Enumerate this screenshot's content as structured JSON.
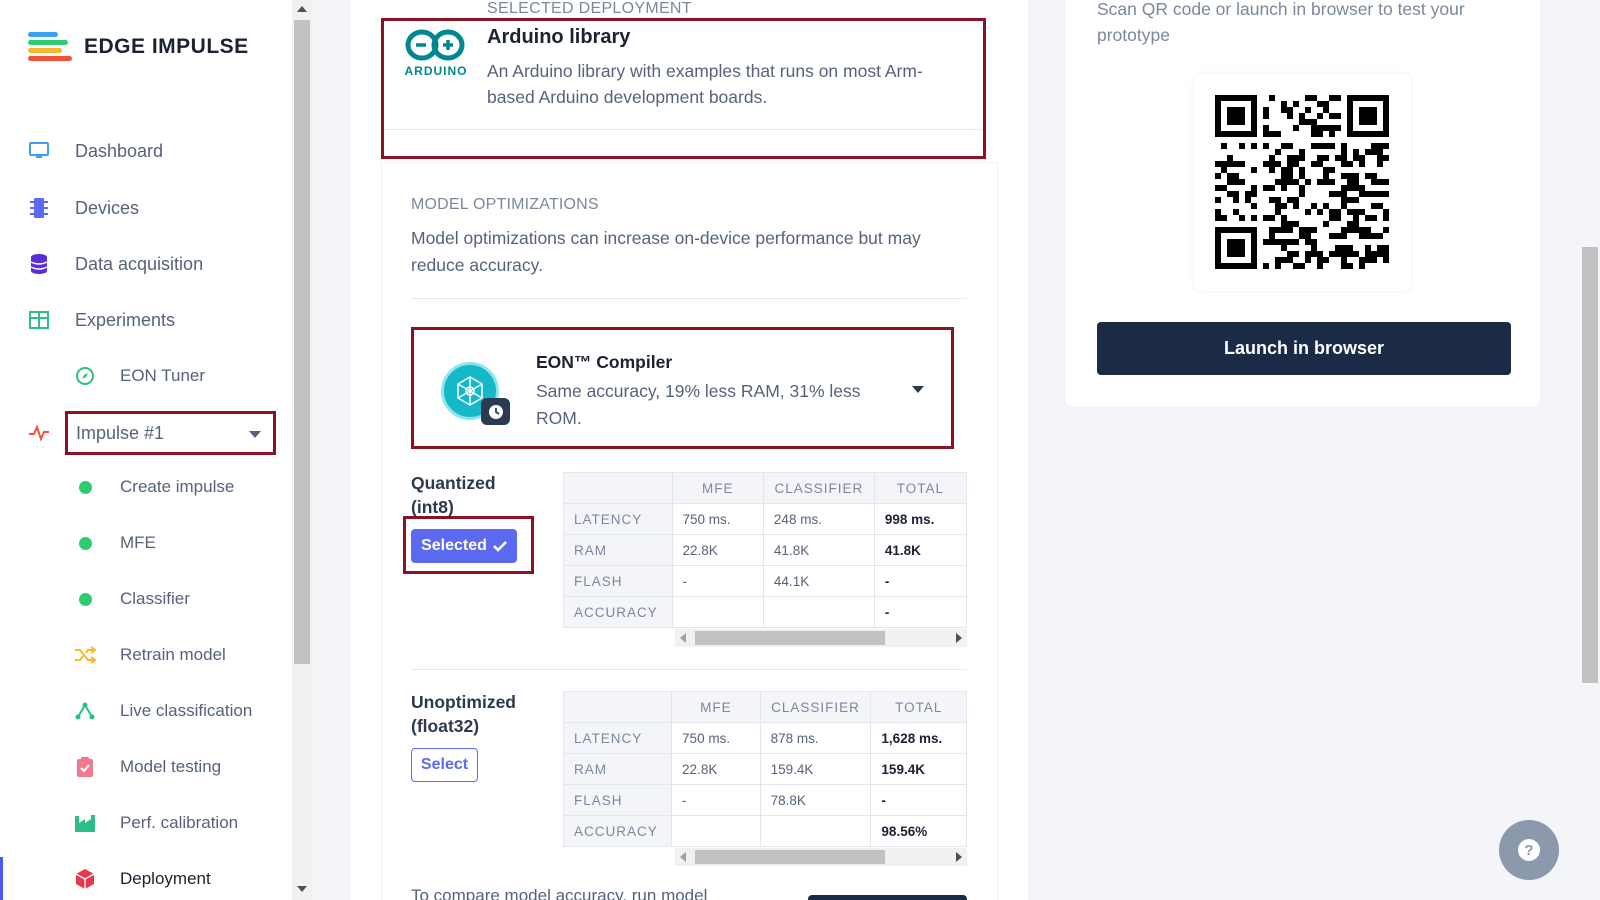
{
  "app": {
    "brand": "EDGE IMPULSE"
  },
  "sidebar": {
    "items": [
      {
        "label": "Dashboard",
        "icon": "monitor-icon"
      },
      {
        "label": "Devices",
        "icon": "chip-icon"
      },
      {
        "label": "Data acquisition",
        "icon": "database-icon"
      },
      {
        "label": "Experiments",
        "icon": "table-icon"
      },
      {
        "label": "EON Tuner",
        "icon": "compass-icon"
      }
    ],
    "impulse_select": "Impulse #1",
    "impulse_items": [
      {
        "label": "Create impulse"
      },
      {
        "label": "MFE"
      },
      {
        "label": "Classifier"
      },
      {
        "label": "Retrain model"
      },
      {
        "label": "Live classification"
      },
      {
        "label": "Model testing"
      },
      {
        "label": "Perf. calibration"
      },
      {
        "label": "Deployment"
      }
    ]
  },
  "deployment": {
    "section_label": "SELECTED DEPLOYMENT",
    "title": "Arduino library",
    "description": "An Arduino library with examples that runs on most Arm-based Arduino development boards.",
    "logo_text": "ARDUINO"
  },
  "optimizations": {
    "section_label": "MODEL OPTIMIZATIONS",
    "description": "Model optimizations can increase on-device performance but may reduce accuracy.",
    "compiler_title": "EON™ Compiler",
    "compiler_desc": "Same accuracy, 19% less RAM, 31% less ROM.",
    "columns": [
      "MFE",
      "CLASSIFIER",
      "TOTAL"
    ],
    "quantized": {
      "title": "Quantized (int8)",
      "button": "Selected",
      "rows": [
        {
          "label": "LATENCY",
          "mfe": "750 ms.",
          "classifier": "248 ms.",
          "total": "998 ms."
        },
        {
          "label": "RAM",
          "mfe": "22.8K",
          "classifier": "41.8K",
          "total": "41.8K"
        },
        {
          "label": "FLASH",
          "mfe": "-",
          "classifier": "44.1K",
          "total": "-"
        },
        {
          "label": "ACCURACY",
          "mfe": "",
          "classifier": "",
          "total": "-"
        }
      ]
    },
    "unoptimized": {
      "title": "Unoptimized (float32)",
      "button": "Select",
      "rows": [
        {
          "label": "LATENCY",
          "mfe": "750 ms.",
          "classifier": "878 ms.",
          "total": "1,628 ms."
        },
        {
          "label": "RAM",
          "mfe": "22.8K",
          "classifier": "159.4K",
          "total": "159.4K"
        },
        {
          "label": "FLASH",
          "mfe": "-",
          "classifier": "78.8K",
          "total": "-"
        },
        {
          "label": "ACCURACY",
          "mfe": "",
          "classifier": "",
          "total": "98.56%"
        }
      ]
    },
    "compare_text": "To compare model accuracy, run model"
  },
  "test_panel": {
    "scan_text": "Scan QR code or launch in browser to test your prototype",
    "launch_button": "Launch in browser"
  },
  "help": {
    "label": "?"
  }
}
